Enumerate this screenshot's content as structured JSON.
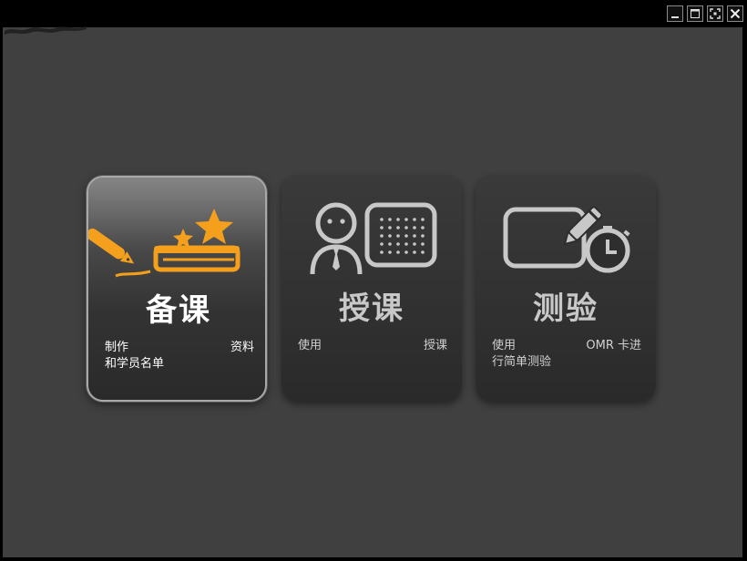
{
  "window_controls": {
    "minimize": "minimize",
    "maximize": "maximize",
    "fullscreen": "fullscreen",
    "close": "close"
  },
  "colors": {
    "accent": "#f5a01c",
    "icon_gray": "#c8c8c8",
    "background": "#404040"
  },
  "cards": [
    {
      "title": "备课",
      "desc_left": "制作",
      "desc_right": "资料",
      "desc_line2": "和学员名单",
      "icon": "pen-book-stars-icon",
      "selected": true
    },
    {
      "title": "授课",
      "desc_left": "使用",
      "desc_right": "授课",
      "desc_line2": "",
      "icon": "teacher-board-icon",
      "selected": false
    },
    {
      "title": "测验",
      "desc_left": "使用",
      "desc_right": "OMR 卡进",
      "desc_line2": "行简单测验",
      "icon": "test-timer-icon",
      "selected": false
    }
  ]
}
